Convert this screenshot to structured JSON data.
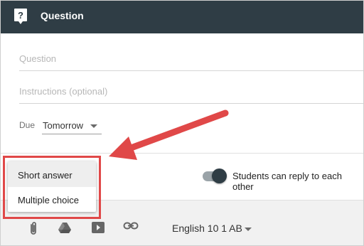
{
  "header": {
    "title": "Question",
    "icon": "question-bubble-icon"
  },
  "form": {
    "question_placeholder": "Question",
    "instructions_placeholder": "Instructions (optional)",
    "due_label": "Due",
    "due_value": "Tomorrow"
  },
  "menu": {
    "items": [
      "Short answer",
      "Multiple choice"
    ],
    "selected_index": 0
  },
  "toggle": {
    "label": "Students can reply to each other",
    "on": true
  },
  "footer": {
    "icons": [
      "paperclip-icon",
      "google-drive-icon",
      "youtube-icon",
      "link-icon"
    ],
    "class_value": "English 10 1 AB"
  },
  "colors": {
    "header_bg": "#2f3d45",
    "annotation": "#e04848",
    "toggle_knob": "#2f3d45"
  }
}
